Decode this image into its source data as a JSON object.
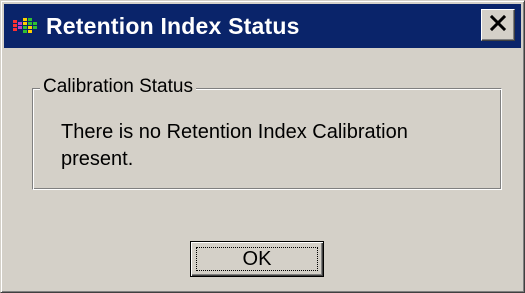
{
  "window": {
    "title": "Retention Index Status",
    "titlebar_color": "#0a246a",
    "face_color": "#d4d0c8",
    "app_icon": "app-icon",
    "close_icon": "close-icon"
  },
  "group": {
    "label": "Calibration Status",
    "message": "There is no Retention Index Calibration present."
  },
  "buttons": {
    "ok_label": "OK"
  }
}
